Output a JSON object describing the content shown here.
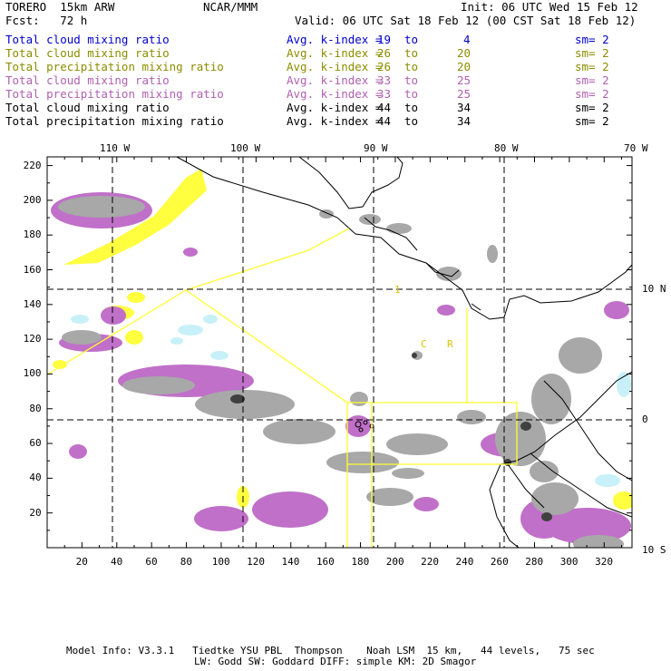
{
  "header": {
    "model": "TORERO  15km ARW",
    "org": "NCAR/MMM",
    "init": "Init: 06 UTC Wed 15 Feb 12",
    "fcst": "Fcst:   72 h",
    "valid": "Valid: 06 UTC Sat 18 Feb 12 (00 CST Sat 18 Feb 12)"
  },
  "colors": {
    "blue": "#0000cc",
    "olive": "#8c8c00",
    "magenta": "#b060b0",
    "black": "#000000",
    "yellow_fill": "#ffff40",
    "cyan_fill": "#c8f0f8",
    "purple_fill": "#c070c8",
    "gray_fill": "#a8a8a8",
    "box_line": "#ffff33"
  },
  "legend": [
    {
      "field": "Total cloud mixing ratio",
      "kidx": "Avg. k-index =",
      "hi": "19",
      "to": "to",
      "lo": "4",
      "sm": "sm= 2",
      "color": "#0000cc"
    },
    {
      "field": "Total cloud mixing ratio",
      "kidx": "Avg. k-index =",
      "hi": "26",
      "to": "to",
      "lo": "20",
      "sm": "sm= 2",
      "color": "#8c8c00"
    },
    {
      "field": "Total precipitation mixing ratio",
      "kidx": "Avg. k-index =",
      "hi": "26",
      "to": "to",
      "lo": "20",
      "sm": "sm= 2",
      "color": "#8c8c00"
    },
    {
      "field": "Total cloud mixing ratio",
      "kidx": "Avg. k-index =",
      "hi": "33",
      "to": "to",
      "lo": "25",
      "sm": "sm= 2",
      "color": "#b060b0"
    },
    {
      "field": "Total precipitation mixing ratio",
      "kidx": "Avg. k-index =",
      "hi": "33",
      "to": "to",
      "lo": "25",
      "sm": "sm= 2",
      "color": "#b060b0"
    },
    {
      "field": "Total cloud mixing ratio",
      "kidx": "Avg. k-index =",
      "hi": "44",
      "to": "to",
      "lo": "34",
      "sm": "sm= 2",
      "color": "#000000"
    },
    {
      "field": "Total precipitation mixing ratio",
      "kidx": "Avg. k-index =",
      "hi": "44",
      "to": "to",
      "lo": "34",
      "sm": "sm= 2",
      "color": "#000000"
    }
  ],
  "map": {
    "lon_labels": [
      "110 W",
      "100 W",
      "90 W",
      "80 W",
      "70 W"
    ],
    "lat_labels": [
      "10 N",
      "0",
      "10 S"
    ],
    "grid_x_labels": [
      "20",
      "40",
      "60",
      "80",
      "100",
      "120",
      "140",
      "160",
      "180",
      "200",
      "220",
      "240",
      "260",
      "280",
      "300",
      "320"
    ],
    "grid_y_labels": [
      "220",
      "200",
      "180",
      "160",
      "140",
      "120",
      "100",
      "80",
      "60",
      "40",
      "20"
    ],
    "grid_x_range": [
      0,
      336
    ],
    "grid_y_range": [
      0,
      225
    ],
    "lon_grid": [
      -110,
      -100,
      -90,
      -80
    ],
    "lat_grid": [
      10,
      0
    ],
    "box_labels": [
      "1",
      "C",
      "R"
    ]
  },
  "footer": {
    "line1": "Model Info: V3.3.1   Tiedtke YSU PBL  Thompson    Noah LSM  15 km,   44 levels,   75 sec",
    "line2": "LW: Godd SW: Goddard DIFF: simple KM: 2D Smagor"
  }
}
